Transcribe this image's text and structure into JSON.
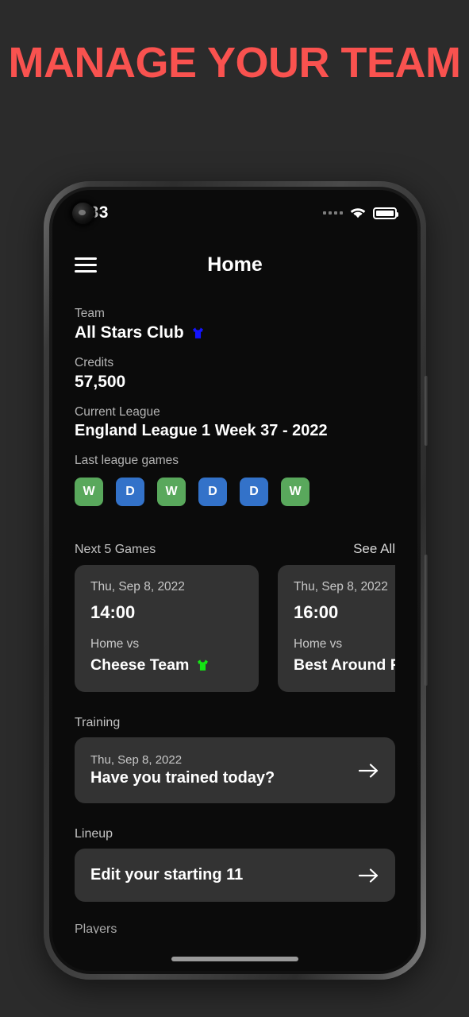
{
  "promo": {
    "headline": "MANAGE YOUR TEAM",
    "accent_color": "#f9524f",
    "background_color": "#2b2b2b"
  },
  "status_bar": {
    "time": "2.33",
    "signal_icon": "signal-dots-icon",
    "wifi_icon": "wifi-icon",
    "battery_icon": "battery-full-icon"
  },
  "app_header": {
    "menu_icon": "hamburger-menu-icon",
    "title": "Home"
  },
  "team": {
    "label": "Team",
    "name": "All Stars Club",
    "kit_color": "#1414ff",
    "kit_icon": "jersey-icon"
  },
  "credits": {
    "label": "Credits",
    "value": "57,500"
  },
  "league": {
    "label": "Current League",
    "value": "England League 1 Week 37 - 2022",
    "form_label": "Last league games",
    "form": [
      {
        "result": "W",
        "color": "#59a85c"
      },
      {
        "result": "D",
        "color": "#3372c9"
      },
      {
        "result": "W",
        "color": "#59a85c"
      },
      {
        "result": "D",
        "color": "#3372c9"
      },
      {
        "result": "D",
        "color": "#3372c9"
      },
      {
        "result": "W",
        "color": "#59a85c"
      }
    ]
  },
  "next_games": {
    "title": "Next 5 Games",
    "see_all": "See All",
    "cards": [
      {
        "date": "Thu, Sep 8, 2022",
        "time": "14:00",
        "venue": "Home vs",
        "opponent": "Cheese Team",
        "kit_color": "#14e414",
        "kit_icon": "jersey-icon"
      },
      {
        "date": "Thu, Sep 8, 2022",
        "time": "16:00",
        "venue": "Home vs",
        "opponent": "Best Around F",
        "kit_color": "#14e414",
        "kit_icon": "jersey-icon"
      }
    ]
  },
  "training": {
    "label": "Training",
    "date": "Thu, Sep 8, 2022",
    "title": "Have you trained today?",
    "arrow_icon": "arrow-right-icon"
  },
  "lineup": {
    "label": "Lineup",
    "title": "Edit your starting 11",
    "arrow_icon": "arrow-right-icon"
  },
  "players": {
    "label": "Players"
  }
}
